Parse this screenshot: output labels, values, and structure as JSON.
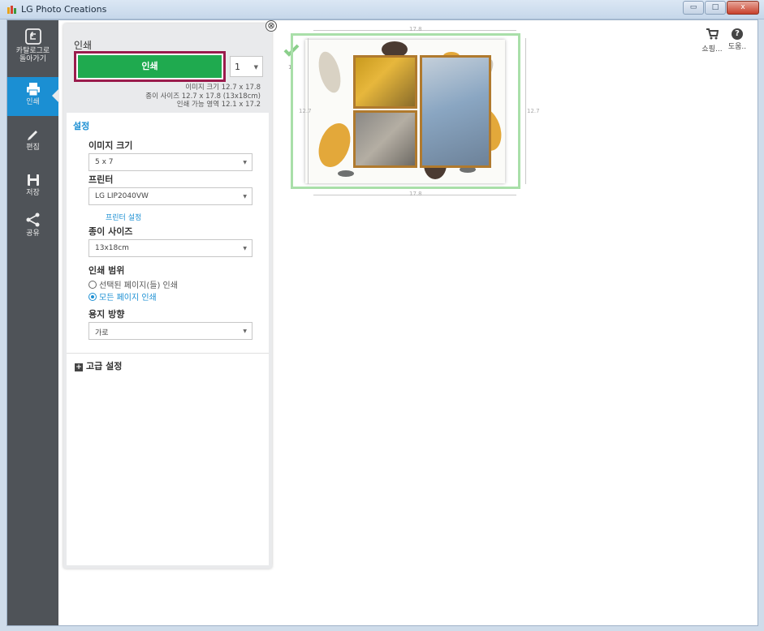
{
  "window": {
    "title": "LG Photo Creations",
    "buttons": [
      "▭",
      "□",
      "x"
    ]
  },
  "leftnav": {
    "items": [
      {
        "id": "back",
        "label_line1": "카탈로그로",
        "label_line2": "돌아가기",
        "icon": "back-arrow-icon"
      },
      {
        "id": "print",
        "label": "인쇄",
        "icon": "printer-icon",
        "active": true
      },
      {
        "id": "edit",
        "label": "편집",
        "icon": "pencil-icon"
      },
      {
        "id": "save",
        "label": "저장",
        "icon": "save-icon"
      },
      {
        "id": "share",
        "label": "공유",
        "icon": "share-icon"
      }
    ]
  },
  "topright": {
    "shop_label": "쇼핑...",
    "help_label": "도움..",
    "help_glyph": "?"
  },
  "panel": {
    "close_glyph": "⊗",
    "title": "인쇄",
    "print_button": "인쇄",
    "copies": "1",
    "copies_arrow": "▼",
    "info_image_size": "이미지 크기 12.7 x 17.8",
    "info_paper_size": "종이 사이즈 12.7 x 17.8 (13x18cm)",
    "info_printable": "인쇄 가능 영역 12.1 x 17.2",
    "settings_title": "설정",
    "image_size_label": "이미지 크기",
    "image_size_value": "5 x 7",
    "printer_label": "프린터",
    "printer_value": "LG LIP2040VW",
    "printer_settings_link": "프린터 설정",
    "paper_size_label": "종이 사이즈",
    "paper_size_value": "13x18cm",
    "print_range_label": "인쇄 범위",
    "range_option_selected_pages": "선택된 페이지(들) 인쇄",
    "range_option_all_pages": "모든 페이지 인쇄",
    "range_selected": "all",
    "orientation_label": "용지 방향",
    "orientation_value": "가로",
    "select_arrow": "▼",
    "advanced_label": "고급 설정",
    "plus_glyph": "+"
  },
  "preview": {
    "width_label": "17.8",
    "height_label": "12.7",
    "page_number": "1"
  },
  "colors": {
    "nav_bg": "#4f5358",
    "active_blue": "#1b8fd3",
    "print_green": "#1faa4f",
    "highlight_border": "#9a1b4c",
    "preview_border": "#a9dfa9",
    "photo_frame": "#b07a2e"
  }
}
